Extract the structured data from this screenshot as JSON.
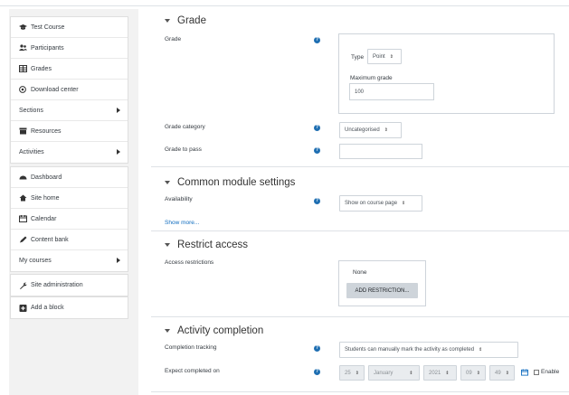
{
  "sidebar": {
    "group1": [
      {
        "label": "Test Course",
        "icon": "graduation-cap-icon"
      },
      {
        "label": "Participants",
        "icon": "users-icon"
      },
      {
        "label": "Grades",
        "icon": "table-icon"
      },
      {
        "label": "Download center",
        "icon": "download-circle-icon"
      },
      {
        "label": "Sections",
        "icon": "",
        "expandable": true
      },
      {
        "label": "Resources",
        "icon": "archive-icon"
      },
      {
        "label": "Activities",
        "icon": "",
        "expandable": true
      }
    ],
    "group2": [
      {
        "label": "Dashboard",
        "icon": "dashboard-icon"
      },
      {
        "label": "Site home",
        "icon": "home-icon"
      },
      {
        "label": "Calendar",
        "icon": "calendar-icon"
      },
      {
        "label": "Content bank",
        "icon": "pen-icon"
      },
      {
        "label": "My courses",
        "icon": "",
        "expandable": true
      }
    ],
    "group3": [
      {
        "label": "Site administration",
        "icon": "wrench-icon"
      }
    ],
    "group4": [
      {
        "label": "Add a block",
        "icon": "plus-square-icon"
      }
    ]
  },
  "grade": {
    "heading": "Grade",
    "grade_label": "Grade",
    "type_label": "Type",
    "type_value": "Point",
    "max_grade_label": "Maximum grade",
    "max_grade_value": "100",
    "category_label": "Grade category",
    "category_value": "Uncategorised",
    "pass_label": "Grade to pass",
    "pass_value": ""
  },
  "common": {
    "heading": "Common module settings",
    "availability_label": "Availability",
    "availability_value": "Show on course page",
    "show_more": "Show more..."
  },
  "restrict": {
    "heading": "Restrict access",
    "access_label": "Access restrictions",
    "none_text": "None",
    "add_button": "ADD RESTRICTION..."
  },
  "completion": {
    "heading": "Activity completion",
    "tracking_label": "Completion tracking",
    "tracking_value": "Students can manually mark the activity as completed",
    "expect_label": "Expect completed on",
    "day": "25",
    "month": "January",
    "year": "2021",
    "hour": "09",
    "minute": "49",
    "enable_label": "Enable"
  },
  "colors": {
    "help_icon": "#1f6fb2",
    "link": "#0f6cbf",
    "sidebar_bg": "#f2f2f2"
  }
}
